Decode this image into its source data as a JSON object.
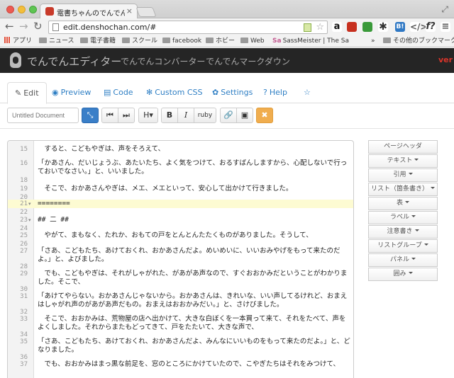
{
  "browser": {
    "tab_title": "電書ちゃんのでんでんエデ",
    "tab_close": "×",
    "url": "edit.denshochan.com/#",
    "back": "←",
    "forward": "→",
    "reload": "↻",
    "star": "☆",
    "window_control": "⤢",
    "extensions": [
      "a",
      "◼",
      "◼",
      "✱",
      "B!",
      "</>",
      "f?",
      "≡"
    ]
  },
  "bookmarks": {
    "items": [
      "アプリ",
      "ニュース",
      "電子書籍",
      "スクール",
      "facebook",
      "ホビー",
      "Web",
      "SassMeister | The Sa"
    ],
    "more": "»",
    "other": "その他のブックマーク",
    "sass_mark": "Sa"
  },
  "navbar": {
    "brand": "でんでんエディター",
    "links": [
      "でんでんコンバーター",
      "でんでんマークダウン"
    ],
    "right_text": "ver"
  },
  "tabs": [
    {
      "icon": "✎",
      "label": "Edit"
    },
    {
      "icon": "◉",
      "label": "Preview"
    },
    {
      "icon": "▤",
      "label": "Code"
    },
    {
      "icon": "✻",
      "label": "Custom CSS"
    },
    {
      "icon": "✿",
      "label": "Settings"
    },
    {
      "icon": "?",
      "label": "Help"
    },
    {
      "icon": "☆",
      "label": ""
    }
  ],
  "toolbar": {
    "doc_placeholder": "Untitled Document",
    "expand": "⤡",
    "prev": "⏮",
    "next": "⏭",
    "heading": "H▾",
    "bold": "B",
    "italic": "I",
    "ruby": "ruby",
    "link": "🔗",
    "image": "▣",
    "close": "✖"
  },
  "editor": {
    "lines": [
      {
        "n": "15",
        "text": "　すると、こどもやぎは、声をそろえて、"
      },
      {
        "n": "16",
        "text": "「かあさん、だいじょうぶ、あたいたち、よく気をつけて、おるすばんしますから、心配しないで行っておいでなさい。」と、いいました。"
      },
      {
        "n": "18",
        "text": ""
      },
      {
        "n": "19",
        "text": "　そこで、おかあさんやぎは、メエ、メエといって、安心して出かけて行きました。"
      },
      {
        "n": "20",
        "text": ""
      },
      {
        "n": "21",
        "text": "========"
      },
      {
        "n": "22",
        "text": ""
      },
      {
        "n": "23",
        "text": "## 二 ##"
      },
      {
        "n": "24",
        "text": ""
      },
      {
        "n": "25",
        "text": "　やがて、まもなく、たれか、おもての戸をとんとんたたくものがありました。そうして、"
      },
      {
        "n": "26",
        "text": ""
      },
      {
        "n": "27",
        "text": "「さあ、こどもたち、あけておくれ、おかあさんだよ。めいめいに、いいおみやげをもって来たのだよ。」と、よびました。"
      },
      {
        "n": "28",
        "text": ""
      },
      {
        "n": "29",
        "text": "　でも、こどもやぎは、それがしゃがれた、があがあ声なので、すぐおおかみだということがわかりました。そこで、"
      },
      {
        "n": "30",
        "text": ""
      },
      {
        "n": "31",
        "text": "「あけてやらない。おかあさんじゃないから。おかあさんは、きれいな、いい声してるけれど、おまえはしゃがれ声のがあがあ声だもの。おまえはおおかみだい。」と、さけびました。"
      },
      {
        "n": "32",
        "text": ""
      },
      {
        "n": "33",
        "text": "　そこで、おおかみは、荒物屋の店へ出かけて、大きな白ぼくを一本買って来て、それをたべて、声をよくしました。それからまたもどってきて、戸をたたいて、大きな声で、"
      },
      {
        "n": "34",
        "text": ""
      },
      {
        "n": "35",
        "text": "「さあ、こどもたち、あけておくれ、おかあさんだよ、みんなにいいものをもって来たのだよ。」と、どなりました。"
      },
      {
        "n": "36",
        "text": ""
      },
      {
        "n": "37",
        "text": "　でも、おおかみはまっ黒な前足を、窓のところにかけていたので、こやぎたちはそれをみつけて、"
      }
    ]
  },
  "sidebar": {
    "buttons": [
      "ページヘッダ",
      "テキスト",
      "引用",
      "リスト（箇条書き）",
      "表",
      "ラベル",
      "注意書き",
      "リストグループ",
      "パネル",
      "囲み"
    ]
  }
}
